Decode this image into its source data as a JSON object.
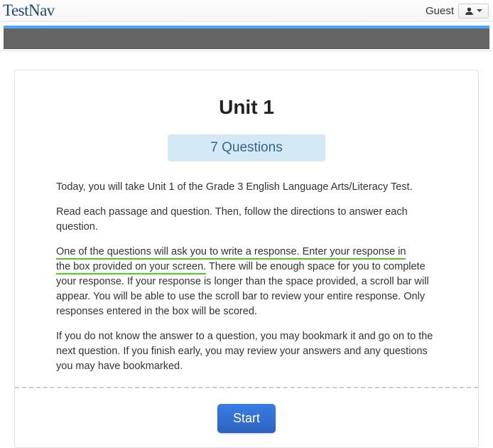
{
  "header": {
    "brand": "TestNav",
    "guest_label": "Guest"
  },
  "card": {
    "title": "Unit 1",
    "questions_badge": "7 Questions",
    "paragraphs": {
      "p1": "Today, you will take Unit 1 of the Grade 3 English Language Arts/Literacy Test.",
      "p2": "Read each passage and question. Then, follow the directions to answer each question.",
      "p3_underlined_a": "One of the questions will ask you to write a response. Enter your response in",
      "p3_underlined_b": "the box provided on your screen.",
      "p3_rest": " There will be enough space for you to complete your response. If your response is longer than the space provided, a scroll bar will appear. You will be able to use the scroll bar to review your entire response. Only responses entered in the box will be scored.",
      "p4": "If you do not know the answer to a question, you may bookmark it and go on to the next question. If you finish early, you may review your answers and any questions you may have bookmarked."
    },
    "start_button": "Start"
  }
}
